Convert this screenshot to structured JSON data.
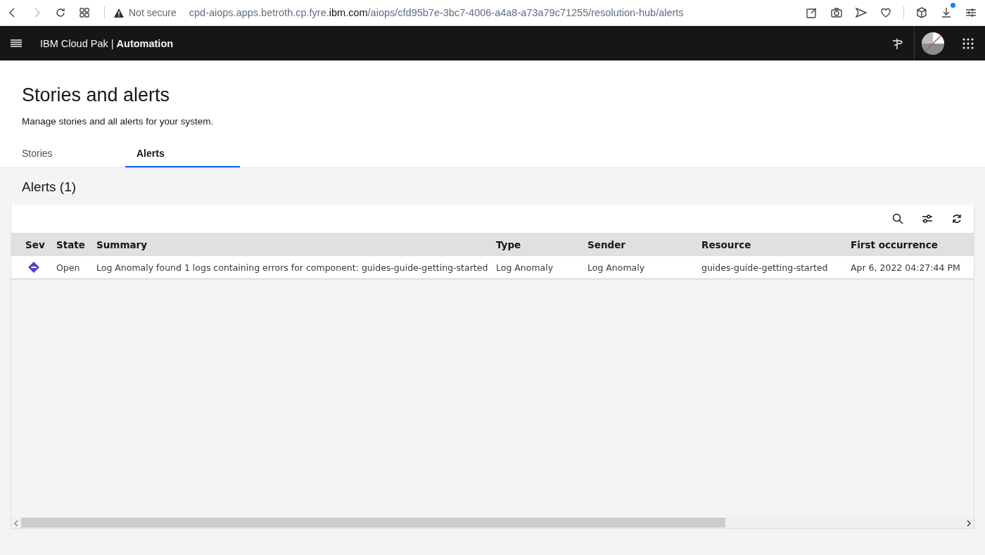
{
  "browser": {
    "security": "Not secure",
    "url": {
      "prefix": "cpd-aiops.apps.betroth.cp.fyre.",
      "domain": "ibm.com",
      "path": "/aiops/cfd95b7e-3bc7-4006-a4a8-a73a79c71255/resolution-hub/alerts"
    }
  },
  "header": {
    "product": "IBM Cloud Pak",
    "separator": "|",
    "product_bold": "Automation"
  },
  "page": {
    "title": "Stories and alerts",
    "subtitle": "Manage stories and all alerts for your system."
  },
  "tabs": [
    {
      "label": "Stories",
      "selected": false
    },
    {
      "label": "Alerts",
      "selected": true
    }
  ],
  "section_title": "Alerts (1)",
  "table": {
    "columns": [
      "Sev",
      "State",
      "Summary",
      "Type",
      "Sender",
      "Resource",
      "First occurrence"
    ],
    "rows": [
      {
        "color": "#5a3ec8",
        "state": "Open",
        "summary": "Log Anomaly found 1 logs containing errors for component: guides-guide-getting-started",
        "type": "Log Anomaly",
        "sender": "Log Anomaly",
        "resource": "guides-guide-getting-started",
        "first_occurrence": "Apr 6, 2022 04:27:44 PM"
      }
    ]
  }
}
